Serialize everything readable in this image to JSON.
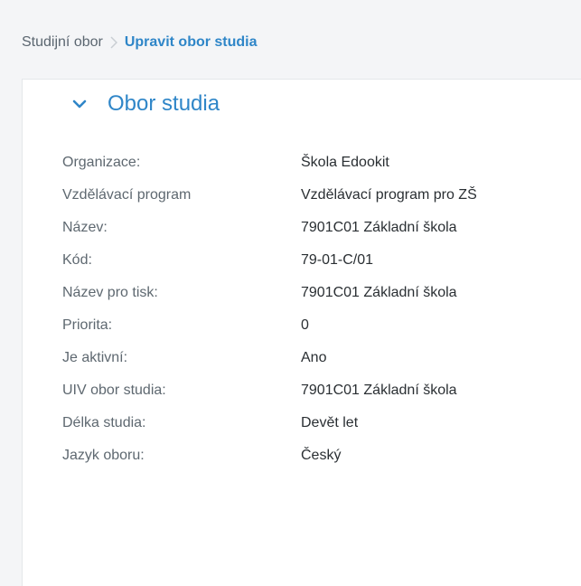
{
  "breadcrumb": {
    "parent": "Studijní obor",
    "current": "Upravit obor studia"
  },
  "section": {
    "title": "Obor studia",
    "icon": "chevron-down-icon"
  },
  "fields": [
    {
      "label": "Organizace:",
      "value": "Škola Edookit"
    },
    {
      "label": "Vzdělávací program",
      "value": "Vzdělávací program pro ZŠ"
    },
    {
      "label": "Název:",
      "value": "7901C01 Základní škola"
    },
    {
      "label": "Kód:",
      "value": "79-01-C/01"
    },
    {
      "label": "Název pro tisk:",
      "value": "7901C01 Základní škola"
    },
    {
      "label": "Priorita:",
      "value": "0"
    },
    {
      "label": "Je aktivní:",
      "value": "Ano"
    },
    {
      "label": "UIV obor studia:",
      "value": "7901C01 Základní škola"
    },
    {
      "label": "Délka studia:",
      "value": "Devět let"
    },
    {
      "label": "Jazyk oboru:",
      "value": "Český"
    }
  ],
  "colors": {
    "accent": "#2f86c8",
    "label": "#5e6870",
    "value": "#2a2f33",
    "background": "#f4f5f7"
  }
}
